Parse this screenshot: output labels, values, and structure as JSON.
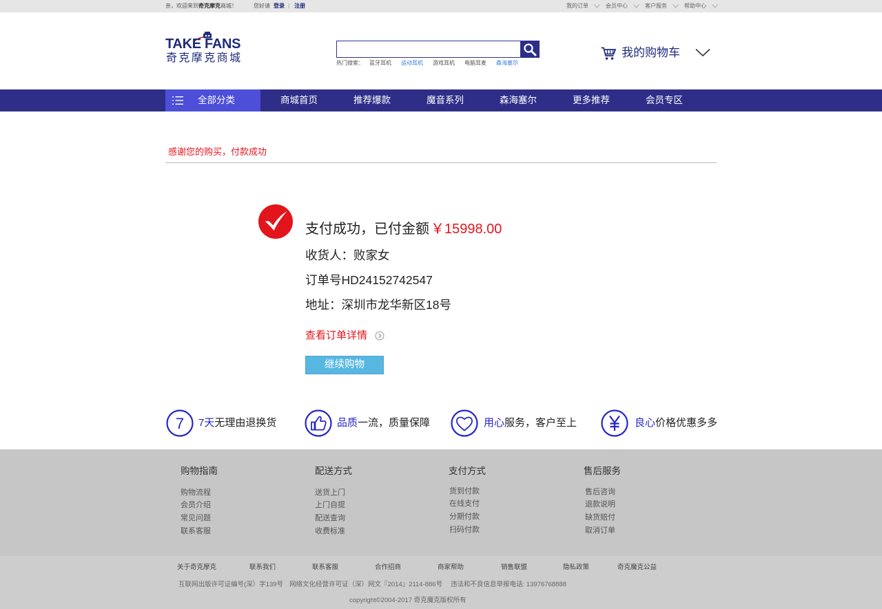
{
  "topbar": {
    "welcome_prefix": "亲，欢迎来到",
    "welcome_brand": "奇克摩克",
    "welcome_suffix": "商城！",
    "greeting": "您好请",
    "login": "登录",
    "separator": "|",
    "register": "注册",
    "links": [
      "我的订单",
      "会员中心",
      "客户服务",
      "帮助中心"
    ]
  },
  "logo": {
    "en": "TAKE FANS",
    "cn": "奇克摩克商城"
  },
  "search": {
    "hot_label": "热门搜索：",
    "hot": [
      {
        "text": "蓝牙耳机",
        "highlight": false
      },
      {
        "text": "运动耳机",
        "highlight": true
      },
      {
        "text": "游戏耳机",
        "highlight": false
      },
      {
        "text": "电脑耳麦",
        "highlight": false
      },
      {
        "text": "森海塞尔",
        "highlight": true
      }
    ],
    "icon": "search-icon"
  },
  "cart": {
    "label": "我的购物车",
    "icon": "cart-icon"
  },
  "nav": {
    "all_categories": "全部分类",
    "items": [
      "商城首页",
      "推荐爆款",
      "魔音系列",
      "森海塞尔",
      "更多推荐",
      "会员专区"
    ]
  },
  "main": {
    "thanks": "感谢您的购买，付款成功",
    "status_text": "支付成功，已付金额",
    "paid_amount": "￥15998.00",
    "receiver": "收货人：败家女",
    "order_no": "订单号HD24152742547",
    "address": "地址：深圳市龙华新区18号",
    "view_order": "查看订单详情",
    "continue_button": "继续购物"
  },
  "features": [
    {
      "icon": "seven-days-icon",
      "icon_text": "7",
      "highlight": "7天",
      "text": "无理由退换货"
    },
    {
      "icon": "thumbs-up-icon",
      "highlight": "品质",
      "text": "一流，质量保障"
    },
    {
      "icon": "heart-icon",
      "highlight": "用心",
      "text": "服务，客户至上"
    },
    {
      "icon": "yen-icon",
      "highlight": "良心",
      "text": "价格优惠多多"
    }
  ],
  "footer": {
    "columns": [
      {
        "title": "购物指南",
        "items": [
          "购物流程",
          "会员介绍",
          "常见问题",
          "联系客服"
        ]
      },
      {
        "title": "配送方式",
        "items": [
          "送货上门",
          "上门自提",
          "配送查询",
          "收费标准"
        ]
      },
      {
        "title": "支付方式",
        "items": [
          "货到付款",
          "在线支付",
          "分期付款",
          "扫码付款"
        ]
      },
      {
        "title": "售后服务",
        "items": [
          "售后咨询",
          "退款说明",
          "缺货赔付",
          "取消订单"
        ]
      }
    ],
    "links": [
      "关于奇克摩克",
      "联系我们",
      "联系客服",
      "合作招商",
      "商家帮助",
      "销售联盟",
      "隐私政策",
      "奇克魔克公益"
    ],
    "license": [
      "互联网出版许可证编号(深）字139号",
      "网络文化经营许可证（深）网文『2014』2114-886号",
      "违法和不良信息举报电话: 13976768888"
    ],
    "copyright": "copyright©2004-2017 奇克魔克版权所有"
  },
  "colors": {
    "topbar_bg": "#e6e6e6",
    "brand_navy": "#1f2b7b",
    "nav_bg": "#2e2e88",
    "nav_active_bg": "#4d4fd8",
    "search_border": "#2c3391",
    "accent_red": "#e3151c",
    "link_blue": "#3b7bd8",
    "feature_blue": "#2626c8",
    "button_blue": "#58b7e0",
    "footer_bg": "#c6c6c6",
    "footer_bottom_bg": "#cdcdcd"
  }
}
